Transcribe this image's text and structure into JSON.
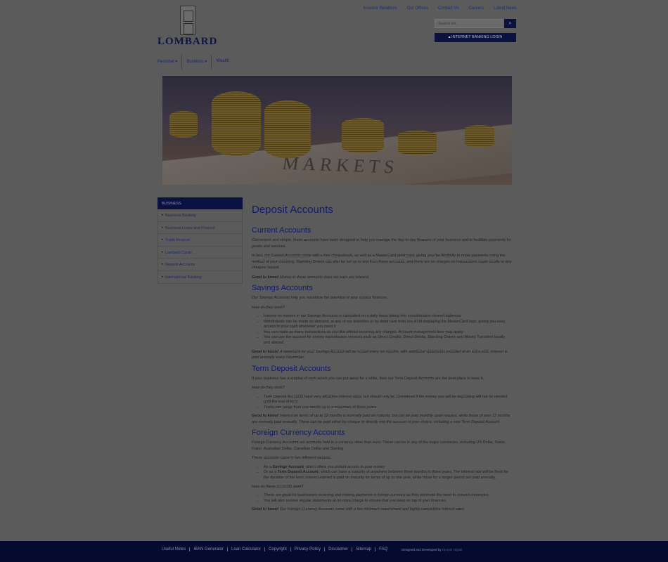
{
  "brand": {
    "name": "LOMBARD"
  },
  "top_links": [
    "Investor Relations",
    "Our Offices",
    "Contact Us",
    "Careers",
    "Latest News"
  ],
  "search": {
    "placeholder": "Search for..."
  },
  "internet_banking": {
    "label": "INTERNET BANKING LOGIN"
  },
  "main_nav": [
    {
      "label": "Personal ▾"
    },
    {
      "label": "Business ▾"
    },
    {
      "label": "Wealth"
    }
  ],
  "hero": {
    "image_text": "MARKETS"
  },
  "sidebar": {
    "heading": "BUSINESS",
    "items": [
      "Business Banking",
      "Business Loans and Finance",
      "Trade Finance",
      "Lombard Cards",
      "Deposit Accounts",
      "International Banking"
    ]
  },
  "content": {
    "title": "Deposit Accounts",
    "current": {
      "heading": "Current Accounts",
      "p1": "Convenient and simple, these accounts have been designed to help you manage the day-to-day finances of your business and to facilitate payments for goods and services.",
      "p2": "In fact, our Current Accounts come with a free chequebook, as well as a MasterCard debit card, giving you the flexibility to make payments using the method of your choosing. Standing Orders can also be set up to and from these accounts, and there are no charges on transactions made locally or any cheques issued.",
      "good_label": "Good to know!",
      "good_text": "Money in these accounts does not earn any interest."
    },
    "savings": {
      "heading": "Savings Accounts",
      "intro": "Our Savings Accounts help you maximise the potential of your surplus finances.",
      "how": "How do they work?",
      "items": [
        "Interest on monies in our Savings Accounts is calculated on a daily basis taking into consideration cleared balances",
        "Withdrawals can be made on demand, at any of our branches or by debit card from any ATM displaying the MasterCard logo, giving you easy access to your cash whenever you need it",
        "You can make as many transactions as you like without incurring any charges. Account management fees may apply.",
        "You can use the account for money transmission services such as Direct Credits, Direct Debits, Standing Orders and Money Transfers locally and abroad."
      ],
      "good_label": "Good to know!",
      "good_text": "A statement for your Savings Account will be issued every six months, with additional statements provided at an extra cost. Interest is paid annually every November."
    },
    "term": {
      "heading": "Term Deposit Accounts",
      "intro": "If your business has a surplus of cash which you can put away for a while, then our Term Deposit Accounts are the best place to keep it.",
      "how": "How do they work?",
      "items": [
        "Term Deposit Accounts have very attractive interest rates, but should only be considered if the money you will be depositing will not be needed until the end of term",
        "Terms can range from one month up to a maximum of three years."
      ],
      "good_label": "Good to know!",
      "good_text": "Interest on terms of up to 12 months is normally paid on maturity, but can be paid monthly upon request, while those of over 12 months are normally paid annually. These can be paid either by cheque or directly into the account of your choice, including a new Term Deposit Account."
    },
    "foreign": {
      "heading": "Foreign Currency Accounts",
      "intro": "Foreign Currency Accounts are accounts held in a currency other than euro. These can be in any of the major currencies, including US Dollar, Swiss Franc, Australian Dollar, Canadian Dollar and Sterling.",
      "variants": "These accounts come in two different variants:",
      "v1_pre": "As a ",
      "v1_b": "Savings Account",
      "v1_post": ", which offers you instant access to your money",
      "v2_pre": "Or as a ",
      "v2_b": "Term Deposit Account",
      "v2_post": ", which can have a maturity of anywhere between three months to three years. The interest rate will be fixed for the duration of the term. Interest earned is paid on maturity for terms of up to one year, while those for a longer period are paid annually.",
      "how": "How do these accounts work?",
      "items": [
        "These are great for businesses receiving and making payments in foreign currency as they eliminate the need to convert currencies",
        "You will also receive regular statements at no extra charge to ensure that you keep on top of your finances."
      ],
      "good_label": "Good to know!",
      "good_text": "Our Foreign Currency Accounts come with a low minimum requirement and highly-competitive interest rates."
    }
  },
  "footer": {
    "links": [
      "Useful Notes",
      "IBAN Generator",
      "Loan Calculator",
      "Copyright",
      "Privacy Policy",
      "Disclaimer",
      "Sitemap",
      "FAQ"
    ],
    "credit_prefix": "Designed and Developed by",
    "credit_name": "Deeper Digital"
  },
  "colors": {
    "navy": "#0b1240",
    "link": "#1a2470",
    "overlay": "#5b5b5b"
  }
}
